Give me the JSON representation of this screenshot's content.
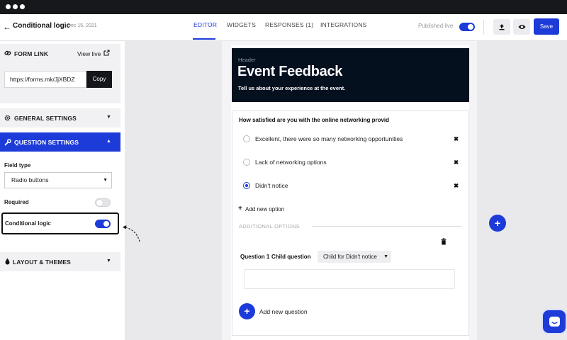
{
  "topbar": {
    "title": "Conditional logic",
    "date": "Dec 15, 2021",
    "tabs": [
      {
        "label": "EDITOR",
        "active": true
      },
      {
        "label": "WIDGETS",
        "active": false
      },
      {
        "label": "RESPONSES (1)",
        "active": false
      },
      {
        "label": "INTEGRATIONS",
        "active": false
      }
    ],
    "published_label": "Published live",
    "published_on": true,
    "save_label": "Save",
    "upload_icon": "upload-icon",
    "preview_icon": "eye-icon"
  },
  "sidebar": {
    "form_link": {
      "title": "FORM LINK",
      "view_live": "View live",
      "url": "https://forms.mk/JjXBDZ",
      "copy": "Copy"
    },
    "general_settings": "GENERAL SETTINGS",
    "question_settings": {
      "title": "QUESTION SETTINGS",
      "field_type_label": "Field type",
      "field_type_value": "Radio buttons",
      "required_label": "Required",
      "required_on": false,
      "conditional_label": "Conditional logic",
      "conditional_on": true
    },
    "layout_themes": "LAYOUT & THEMES"
  },
  "form": {
    "header_label": "Header",
    "title": "Event Feedback",
    "subtitle": "Tell us about your experience at the event.",
    "question": "How satisfied are you with the online networking provid",
    "options": [
      {
        "label": "Excellent, there were so many networking opportunities",
        "checked": false
      },
      {
        "label": "Lack of networking options",
        "checked": false
      },
      {
        "label": "Didn't notice",
        "checked": true
      }
    ],
    "add_option": "Add new option",
    "additional_options": "ADDITIONAL OPTIONS",
    "child": {
      "question_num": "Question 1",
      "child_label": "Child question",
      "child_for": "Child for Didn't notice"
    },
    "add_question": "Add new question"
  },
  "colors": {
    "accent": "#1d3bd8",
    "header_bg": "#05101f",
    "topbar_dark": "#17181c"
  }
}
